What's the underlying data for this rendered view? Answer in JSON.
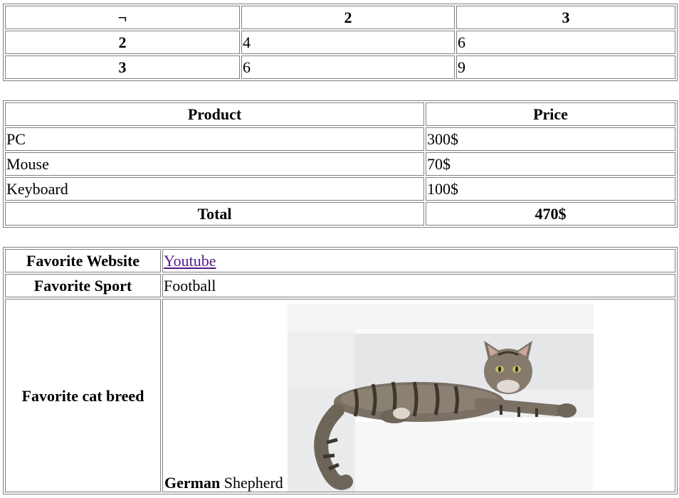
{
  "multiplication_table": {
    "corner": "¬",
    "col_headers": [
      "2",
      "3"
    ],
    "rows": [
      {
        "header": "2",
        "cells": [
          "4",
          "6"
        ]
      },
      {
        "header": "3",
        "cells": [
          "6",
          "9"
        ]
      }
    ]
  },
  "price_table": {
    "headers": {
      "product": "Product",
      "price": "Price"
    },
    "rows": [
      {
        "product": "PC",
        "price": "300$"
      },
      {
        "product": "Mouse",
        "price": "70$"
      },
      {
        "product": "Keyboard",
        "price": "100$"
      }
    ],
    "total": {
      "label": "Total",
      "value": "470$"
    }
  },
  "favorites_table": {
    "website": {
      "label": "Favorite Website",
      "value": "Youtube"
    },
    "sport": {
      "label": "Favorite Sport",
      "value": "Football"
    },
    "cat": {
      "label": "Favorite cat breed",
      "caption_bold": "German",
      "caption_normal": "Shepherd",
      "image_icon": "tabby-cat-photo"
    }
  }
}
